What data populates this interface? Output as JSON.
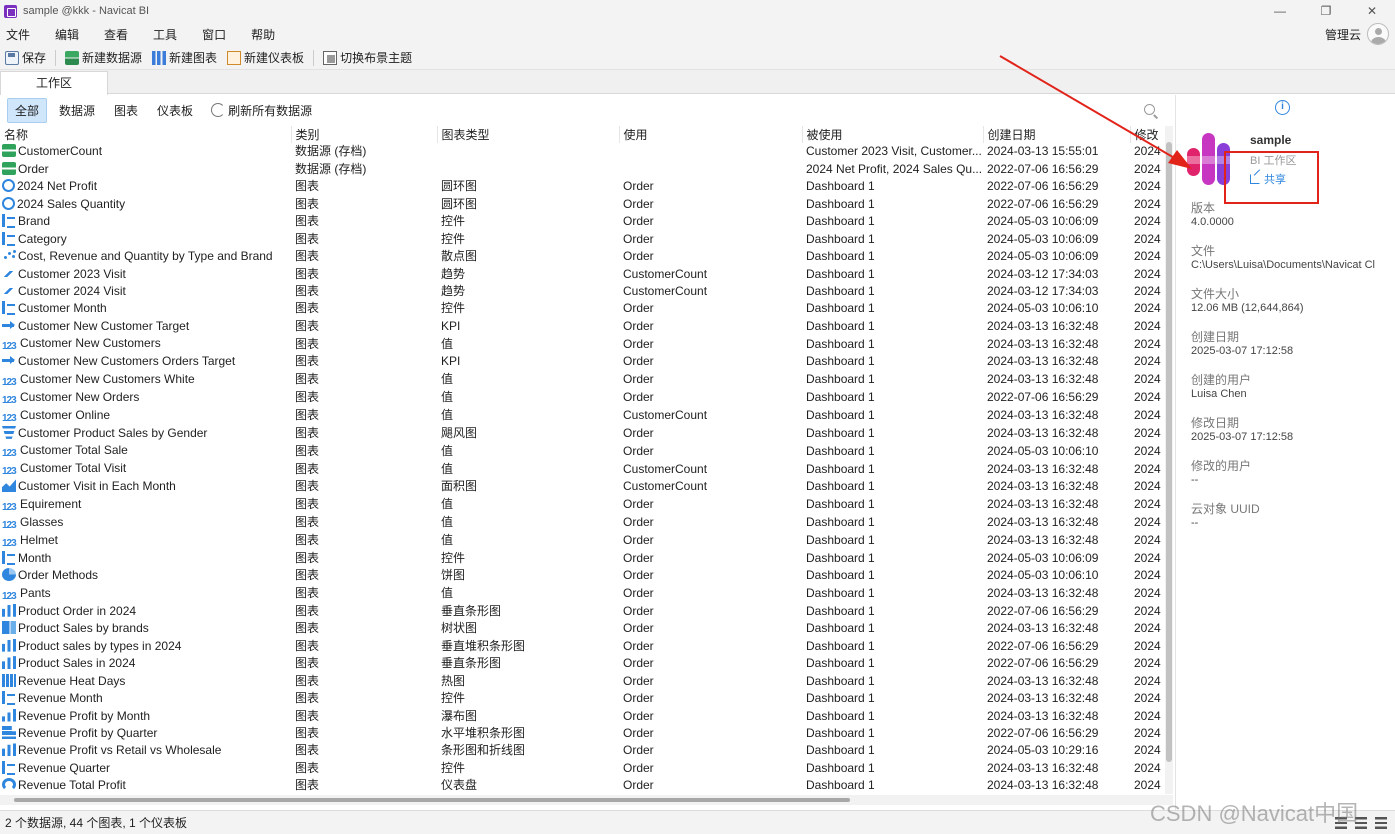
{
  "window": {
    "title": "sample @kkk - Navicat BI",
    "minimize": "—",
    "restore": "❐",
    "close": "✕"
  },
  "menu": [
    "文件",
    "编辑",
    "查看",
    "工具",
    "窗口",
    "帮助"
  ],
  "account": {
    "label": "管理云"
  },
  "toolbar": {
    "save": "保存",
    "new_datasource": "新建数据源",
    "new_chart": "新建图表",
    "new_dashboard": "新建仪表板",
    "switch_theme": "切换布景主题"
  },
  "tabs": {
    "workspace": "工作区"
  },
  "filters": {
    "all": "全部",
    "datasource": "数据源",
    "chart": "图表",
    "dashboard": "仪表板",
    "refresh_all": "刷新所有数据源"
  },
  "table": {
    "columns": [
      "名称",
      "类别",
      "图表类型",
      "使用",
      "被使用",
      "创建日期",
      "修改"
    ],
    "rows": [
      {
        "icon": "datasource",
        "name": "CustomerCount",
        "category": "数据源 (存档)",
        "type": "",
        "uses": "",
        "used_by": "Customer 2023 Visit, Customer...",
        "created": "2024-03-13 15:55:01",
        "modified": "2024"
      },
      {
        "icon": "datasource",
        "name": "Order",
        "category": "数据源 (存档)",
        "type": "",
        "uses": "",
        "used_by": "2024 Net Profit, 2024 Sales Qu...",
        "created": "2022-07-06 16:56:29",
        "modified": "2024"
      },
      {
        "icon": "donut",
        "name": "2024 Net Profit",
        "category": "图表",
        "type": "圆环图",
        "uses": "Order",
        "used_by": "Dashboard 1",
        "created": "2022-07-06 16:56:29",
        "modified": "2024"
      },
      {
        "icon": "donut",
        "name": "2024 Sales Quantity",
        "category": "图表",
        "type": "圆环图",
        "uses": "Order",
        "used_by": "Dashboard 1",
        "created": "2022-07-06 16:56:29",
        "modified": "2024"
      },
      {
        "icon": "control",
        "name": "Brand",
        "category": "图表",
        "type": "控件",
        "uses": "Order",
        "used_by": "Dashboard 1",
        "created": "2024-05-03 10:06:09",
        "modified": "2024"
      },
      {
        "icon": "control",
        "name": "Category",
        "category": "图表",
        "type": "控件",
        "uses": "Order",
        "used_by": "Dashboard 1",
        "created": "2024-05-03 10:06:09",
        "modified": "2024"
      },
      {
        "icon": "scatter",
        "name": "Cost, Revenue and Quantity by Type and Brand",
        "category": "图表",
        "type": "散点图",
        "uses": "Order",
        "used_by": "Dashboard 1",
        "created": "2024-05-03 10:06:09",
        "modified": "2024"
      },
      {
        "icon": "trend",
        "name": "Customer 2023 Visit",
        "category": "图表",
        "type": "趋势",
        "uses": "CustomerCount",
        "used_by": "Dashboard 1",
        "created": "2024-03-12 17:34:03",
        "modified": "2024"
      },
      {
        "icon": "trend",
        "name": "Customer 2024 Visit",
        "category": "图表",
        "type": "趋势",
        "uses": "CustomerCount",
        "used_by": "Dashboard 1",
        "created": "2024-03-12 17:34:03",
        "modified": "2024"
      },
      {
        "icon": "control",
        "name": "Customer Month",
        "category": "图表",
        "type": "控件",
        "uses": "Order",
        "used_by": "Dashboard 1",
        "created": "2024-05-03 10:06:10",
        "modified": "2024"
      },
      {
        "icon": "kpi",
        "name": "Customer New Customer Target",
        "category": "图表",
        "type": "KPI",
        "uses": "Order",
        "used_by": "Dashboard 1",
        "created": "2024-03-13 16:32:48",
        "modified": "2024"
      },
      {
        "icon": "value",
        "name": "Customer New Customers",
        "category": "图表",
        "type": "值",
        "uses": "Order",
        "used_by": "Dashboard 1",
        "created": "2024-03-13 16:32:48",
        "modified": "2024"
      },
      {
        "icon": "kpi",
        "name": "Customer New Customers Orders Target",
        "category": "图表",
        "type": "KPI",
        "uses": "Order",
        "used_by": "Dashboard 1",
        "created": "2024-03-13 16:32:48",
        "modified": "2024"
      },
      {
        "icon": "value",
        "name": "Customer New Customers White",
        "category": "图表",
        "type": "值",
        "uses": "Order",
        "used_by": "Dashboard 1",
        "created": "2024-03-13 16:32:48",
        "modified": "2024"
      },
      {
        "icon": "value",
        "name": "Customer New Orders",
        "category": "图表",
        "type": "值",
        "uses": "Order",
        "used_by": "Dashboard 1",
        "created": "2022-07-06 16:56:29",
        "modified": "2024"
      },
      {
        "icon": "value",
        "name": "Customer Online",
        "category": "图表",
        "type": "值",
        "uses": "CustomerCount",
        "used_by": "Dashboard 1",
        "created": "2024-03-13 16:32:48",
        "modified": "2024"
      },
      {
        "icon": "funnel",
        "name": "Customer Product Sales by Gender",
        "category": "图表",
        "type": "飓风图",
        "uses": "Order",
        "used_by": "Dashboard 1",
        "created": "2024-03-13 16:32:48",
        "modified": "2024"
      },
      {
        "icon": "value",
        "name": "Customer Total Sale",
        "category": "图表",
        "type": "值",
        "uses": "Order",
        "used_by": "Dashboard 1",
        "created": "2024-05-03 10:06:10",
        "modified": "2024"
      },
      {
        "icon": "value",
        "name": "Customer Total Visit",
        "category": "图表",
        "type": "值",
        "uses": "CustomerCount",
        "used_by": "Dashboard 1",
        "created": "2024-03-13 16:32:48",
        "modified": "2024"
      },
      {
        "icon": "area",
        "name": "Customer Visit in Each Month",
        "category": "图表",
        "type": "面积图",
        "uses": "CustomerCount",
        "used_by": "Dashboard 1",
        "created": "2024-03-13 16:32:48",
        "modified": "2024"
      },
      {
        "icon": "value",
        "name": "Equirement",
        "category": "图表",
        "type": "值",
        "uses": "Order",
        "used_by": "Dashboard 1",
        "created": "2024-03-13 16:32:48",
        "modified": "2024"
      },
      {
        "icon": "value",
        "name": "Glasses",
        "category": "图表",
        "type": "值",
        "uses": "Order",
        "used_by": "Dashboard 1",
        "created": "2024-03-13 16:32:48",
        "modified": "2024"
      },
      {
        "icon": "value",
        "name": "Helmet",
        "category": "图表",
        "type": "值",
        "uses": "Order",
        "used_by": "Dashboard 1",
        "created": "2024-03-13 16:32:48",
        "modified": "2024"
      },
      {
        "icon": "control",
        "name": "Month",
        "category": "图表",
        "type": "控件",
        "uses": "Order",
        "used_by": "Dashboard 1",
        "created": "2024-05-03 10:06:09",
        "modified": "2024"
      },
      {
        "icon": "pie",
        "name": "Order Methods",
        "category": "图表",
        "type": "饼图",
        "uses": "Order",
        "used_by": "Dashboard 1",
        "created": "2024-05-03 10:06:10",
        "modified": "2024"
      },
      {
        "icon": "value",
        "name": "Pants",
        "category": "图表",
        "type": "值",
        "uses": "Order",
        "used_by": "Dashboard 1",
        "created": "2024-03-13 16:32:48",
        "modified": "2024"
      },
      {
        "icon": "bars",
        "name": "Product Order in 2024",
        "category": "图表",
        "type": "垂直条形图",
        "uses": "Order",
        "used_by": "Dashboard 1",
        "created": "2022-07-06 16:56:29",
        "modified": "2024"
      },
      {
        "icon": "tree",
        "name": "Product Sales by brands",
        "category": "图表",
        "type": "树状图",
        "uses": "Order",
        "used_by": "Dashboard 1",
        "created": "2024-03-13 16:32:48",
        "modified": "2024"
      },
      {
        "icon": "bars",
        "name": "Product sales by types in 2024",
        "category": "图表",
        "type": "垂直堆积条形图",
        "uses": "Order",
        "used_by": "Dashboard 1",
        "created": "2022-07-06 16:56:29",
        "modified": "2024"
      },
      {
        "icon": "bars",
        "name": "Product Sales in 2024",
        "category": "图表",
        "type": "垂直条形图",
        "uses": "Order",
        "used_by": "Dashboard 1",
        "created": "2022-07-06 16:56:29",
        "modified": "2024"
      },
      {
        "icon": "heat",
        "name": "Revenue Heat Days",
        "category": "图表",
        "type": "热图",
        "uses": "Order",
        "used_by": "Dashboard 1",
        "created": "2024-03-13 16:32:48",
        "modified": "2024"
      },
      {
        "icon": "control",
        "name": "Revenue Month",
        "category": "图表",
        "type": "控件",
        "uses": "Order",
        "used_by": "Dashboard 1",
        "created": "2024-03-13 16:32:48",
        "modified": "2024"
      },
      {
        "icon": "waterfall",
        "name": "Revenue Profit by Month",
        "category": "图表",
        "type": "瀑布图",
        "uses": "Order",
        "used_by": "Dashboard 1",
        "created": "2024-03-13 16:32:48",
        "modified": "2024"
      },
      {
        "icon": "hbar",
        "name": "Revenue Profit by Quarter",
        "category": "图表",
        "type": "水平堆积条形图",
        "uses": "Order",
        "used_by": "Dashboard 1",
        "created": "2022-07-06 16:56:29",
        "modified": "2024"
      },
      {
        "icon": "bars",
        "name": "Revenue Profit vs Retail vs Wholesale",
        "category": "图表",
        "type": "条形图和折线图",
        "uses": "Order",
        "used_by": "Dashboard 1",
        "created": "2024-05-03 10:29:16",
        "modified": "2024"
      },
      {
        "icon": "control",
        "name": "Revenue Quarter",
        "category": "图表",
        "type": "控件",
        "uses": "Order",
        "used_by": "Dashboard 1",
        "created": "2024-03-13 16:32:48",
        "modified": "2024"
      },
      {
        "icon": "gauge",
        "name": "Revenue Total Profit",
        "category": "图表",
        "type": "仪表盘",
        "uses": "Order",
        "used_by": "Dashboard 1",
        "created": "2024-03-13 16:32:48",
        "modified": "2024"
      }
    ]
  },
  "status": {
    "summary": "2 个数据源, 44 个图表, 1 个仪表板"
  },
  "sidebar": {
    "name": "sample",
    "subtitle": "BI 工作区",
    "share": "共享",
    "props": [
      {
        "label": "版本",
        "value": "4.0.0000"
      },
      {
        "label": "文件",
        "value": "C:\\Users\\Luisa\\Documents\\Navicat Cl"
      },
      {
        "label": "文件大小",
        "value": "12.06 MB (12,644,864)"
      },
      {
        "label": "创建日期",
        "value": "2025-03-07 17:12:58"
      },
      {
        "label": "创建的用户",
        "value": "Luisa  Chen"
      },
      {
        "label": "修改日期",
        "value": "2025-03-07 17:12:58"
      },
      {
        "label": "修改的用户",
        "value": "--"
      },
      {
        "label": "云对象 UUID",
        "value": "--"
      }
    ]
  },
  "watermark": "CSDN @Navicat中国",
  "colors": {
    "accent": "#2f86de",
    "annotation": "#e2231a",
    "selected_chip": "#cfe6fb"
  }
}
